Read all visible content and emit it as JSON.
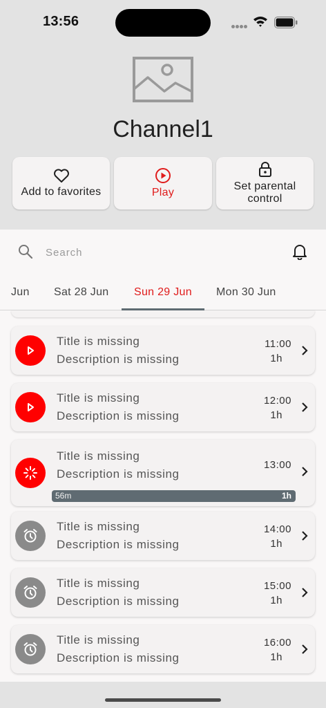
{
  "status": {
    "time": "13:56"
  },
  "channel": {
    "title": "Channel1"
  },
  "actions": {
    "favorites_label": "Add to favorites",
    "play_label": "Play",
    "parental_label": "Set parental control"
  },
  "search": {
    "placeholder": "Search",
    "value": ""
  },
  "tabs": [
    {
      "label": "Jun"
    },
    {
      "label": "Sat 28 Jun"
    },
    {
      "label": "Sun 29 Jun"
    },
    {
      "label": "Mon 30 Jun"
    }
  ],
  "active_tab": "Sun 29 Jun",
  "programs": [
    {
      "title": "Title is missing",
      "description": "Description is missing",
      "time": "11:00",
      "duration": "1h",
      "state": "play-icon"
    },
    {
      "title": "Title is missing",
      "description": "Description is missing",
      "time": "12:00",
      "duration": "1h",
      "state": "play-icon"
    },
    {
      "title": "Title is missing",
      "description": "Description is missing",
      "time": "13:00",
      "duration": "",
      "state": "live-icon",
      "progress": {
        "elapsed_label": "56m",
        "total_label": "1h",
        "fraction": 1.0
      }
    },
    {
      "title": "Title is missing",
      "description": "Description is missing",
      "time": "14:00",
      "duration": "1h",
      "state": "alarm-icon"
    },
    {
      "title": "Title is missing",
      "description": "Description is missing",
      "time": "15:00",
      "duration": "1h",
      "state": "alarm-icon"
    },
    {
      "title": "Title is missing",
      "description": "Description is missing",
      "time": "16:00",
      "duration": "1h",
      "state": "alarm-icon"
    }
  ],
  "colors": {
    "accent": "#e01b1b",
    "live": "#ff0000",
    "upcoming": "#8a8a8a",
    "progress": "#5f6b72"
  }
}
